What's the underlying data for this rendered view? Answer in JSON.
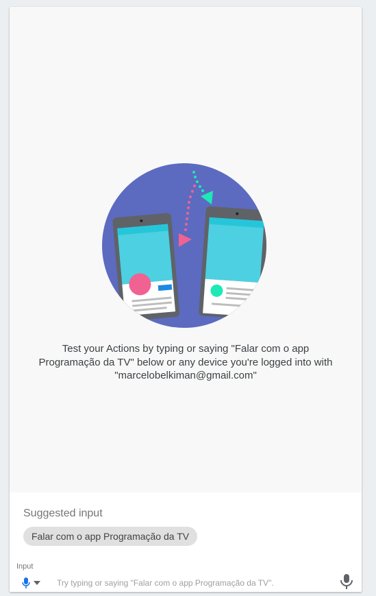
{
  "hero": {
    "illustration": "phones-conversation-illustration",
    "message": "Test your Actions by typing or saying \"Falar com o app Programação da TV\" below or any device you're logged into with \"marcelobelkiman@gmail.com\""
  },
  "suggestions": {
    "title": "Suggested input",
    "chips": [
      {
        "label": "Falar com o app Programação da TV"
      }
    ]
  },
  "input": {
    "label": "Input",
    "mode_icon": "mic-icon",
    "dropdown_icon": "caret-down-icon",
    "placeholder": "Try typing or saying \"Falar com o app Programação da TV\".",
    "value": "",
    "send_icon": "mic-icon"
  },
  "colors": {
    "circle": "#5c6bc0",
    "phone_frame": "#5f6368",
    "screen": "#4dd0e1",
    "pink": "#f06292",
    "green": "#1de9b6",
    "accent_blue": "#1a73e8"
  }
}
